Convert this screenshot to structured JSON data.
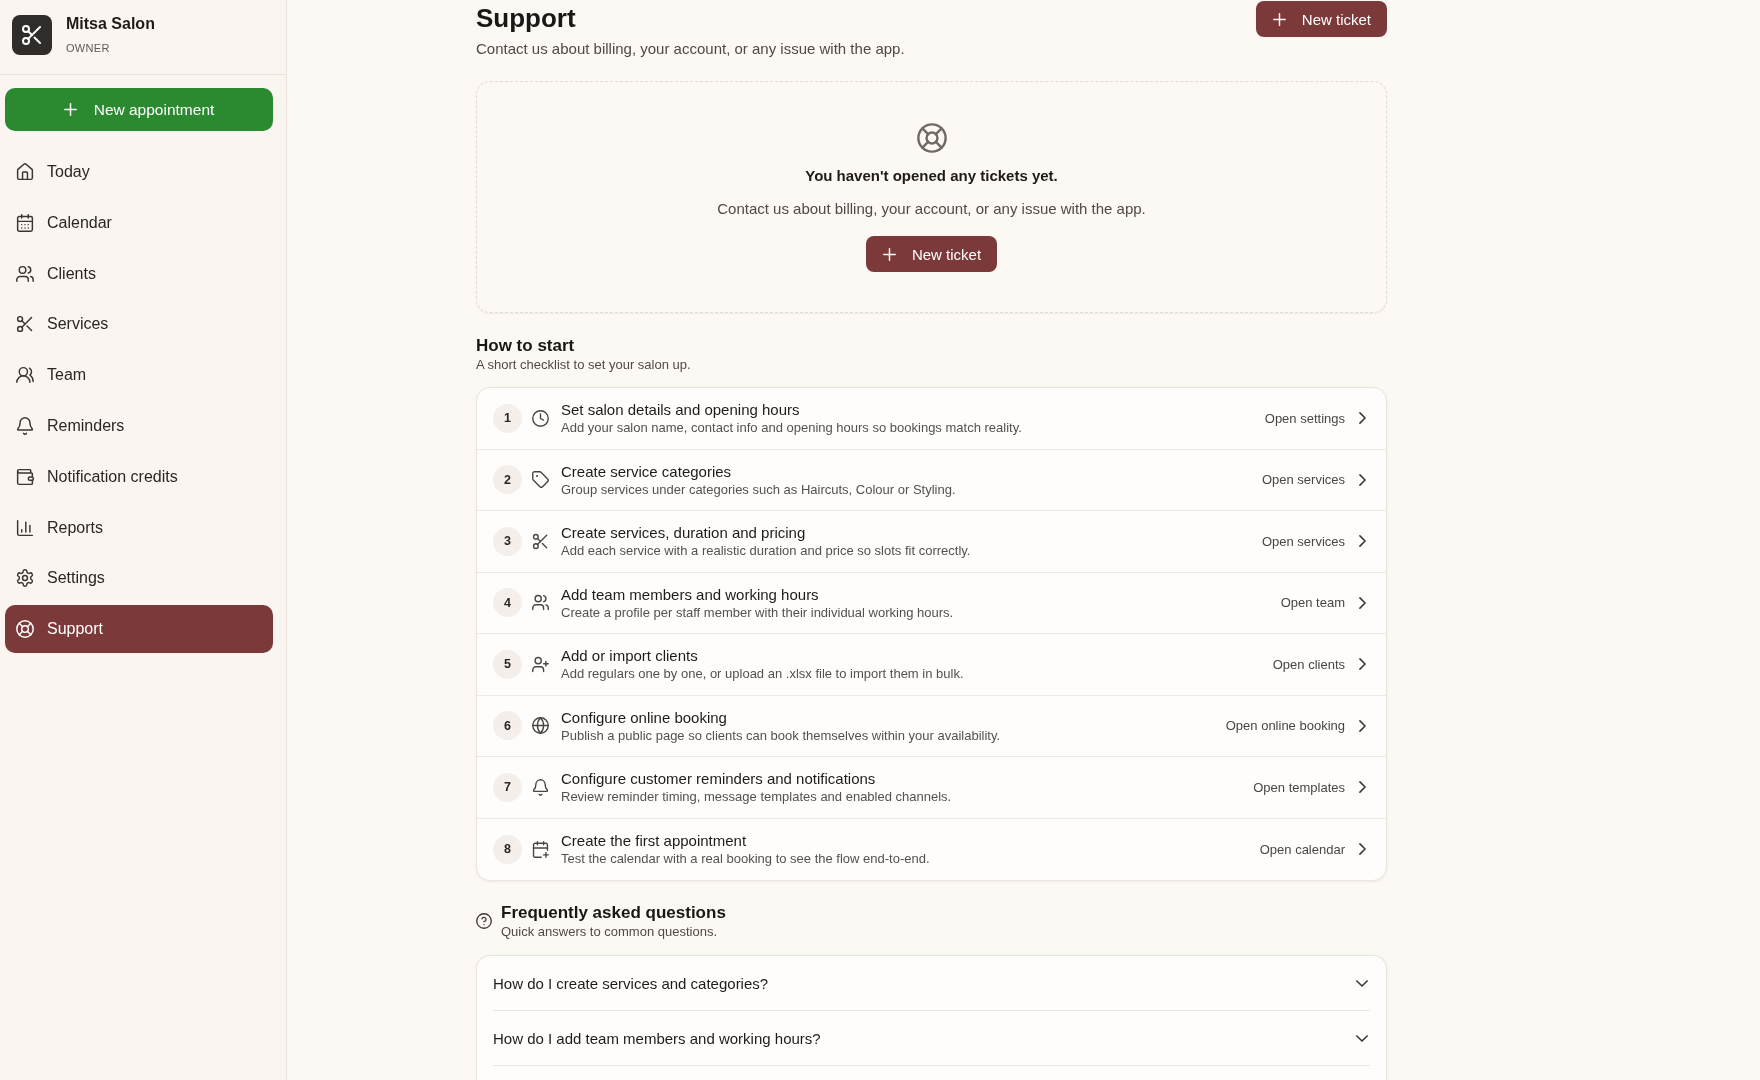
{
  "sidebar": {
    "brand": {
      "name": "Mitsa Salon",
      "role": "OWNER"
    },
    "new_appointment": {
      "label": "New appointment"
    },
    "items": [
      {
        "label": "Today",
        "selected": false
      },
      {
        "label": "Calendar",
        "selected": false
      },
      {
        "label": "Clients",
        "selected": false
      },
      {
        "label": "Services",
        "selected": false
      },
      {
        "label": "Team",
        "selected": false
      },
      {
        "label": "Reminders",
        "selected": false
      },
      {
        "label": "Notification credits",
        "selected": false
      },
      {
        "label": "Reports",
        "selected": false
      },
      {
        "label": "Settings",
        "selected": false
      },
      {
        "label": "Support",
        "selected": true
      }
    ]
  },
  "header": {
    "title": "Support",
    "subtitle": "Contact us about billing, your account, or any issue with the app.",
    "new_ticket": {
      "label": "New ticket"
    }
  },
  "empty_state": {
    "title": "You haven't opened any tickets yet.",
    "description": "Contact us about billing, your account, or any issue with the app.",
    "new_ticket": {
      "label": "New ticket"
    }
  },
  "checklist": {
    "title": "How to start",
    "subtitle": "A short checklist to set your salon up.",
    "steps": [
      {
        "number": "1",
        "title": "Set salon details and opening hours",
        "description": "Add your salon name, contact info and opening hours so bookings match reality.",
        "link": "Open settings"
      },
      {
        "number": "2",
        "title": "Create service categories",
        "description": "Group services under categories such as Haircuts, Colour or Styling.",
        "link": "Open services"
      },
      {
        "number": "3",
        "title": "Create services, duration and pricing",
        "description": "Add each service with a realistic duration and price so slots fit correctly.",
        "link": "Open services"
      },
      {
        "number": "4",
        "title": "Add team members and working hours",
        "description": "Create a profile per staff member with their individual working hours.",
        "link": "Open team"
      },
      {
        "number": "5",
        "title": "Add or import clients",
        "description": "Add regulars one by one, or upload an .xlsx file to import them in bulk.",
        "link": "Open clients"
      },
      {
        "number": "6",
        "title": "Configure online booking",
        "description": "Publish a public page so clients can book themselves within your availability.",
        "link": "Open online booking"
      },
      {
        "number": "7",
        "title": "Configure customer reminders and notifications",
        "description": "Review reminder timing, message templates and enabled channels.",
        "link": "Open templates"
      },
      {
        "number": "8",
        "title": "Create the first appointment",
        "description": "Test the calendar with a real booking to see the flow end-to-end.",
        "link": "Open calendar"
      }
    ]
  },
  "faq": {
    "title": "Frequently asked questions",
    "subtitle": "Quick answers to common questions.",
    "questions": [
      {
        "question": "How do I create services and categories?",
        "expanded": false
      },
      {
        "question": "How do I add team members and working hours?",
        "expanded": false
      }
    ]
  }
}
